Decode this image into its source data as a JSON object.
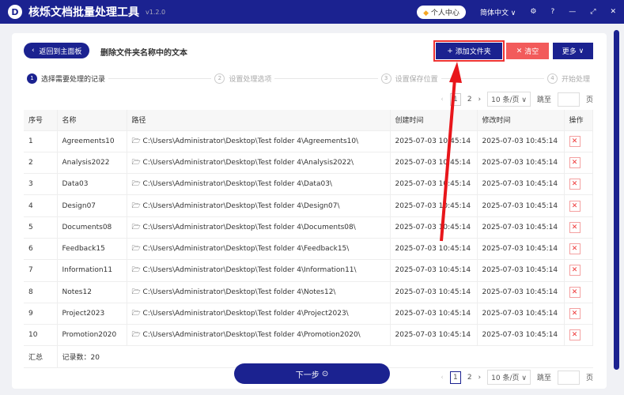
{
  "app": {
    "title": "核烁文档批量处理工具",
    "version": "v1.2.0",
    "personal_center": "个人中心",
    "language": "简体中文 ∨"
  },
  "toolbar": {
    "back": "返回到主面板",
    "page_title": "删除文件夹名称中的文本",
    "add_folder": "添加文件夹",
    "clear": "清空",
    "more": "更多"
  },
  "steps": [
    {
      "n": "1",
      "label": "选择需要处理的记录"
    },
    {
      "n": "2",
      "label": "设置处理选项"
    },
    {
      "n": "3",
      "label": "设置保存位置"
    },
    {
      "n": "4",
      "label": "开始处理"
    }
  ],
  "pager": {
    "pages": [
      "1",
      "2"
    ],
    "page_size": "10 条/页",
    "jump_label": "跳至",
    "page_unit": "页"
  },
  "table": {
    "headers": [
      "序号",
      "名称",
      "路径",
      "创建时间",
      "修改时间",
      "操作"
    ],
    "rows": [
      [
        "1",
        "Agreements10",
        "C:\\Users\\Administrator\\Desktop\\Test folder 4\\Agreements10\\",
        "2025-07-03 10:45:14",
        "2025-07-03 10:45:14"
      ],
      [
        "2",
        "Analysis2022",
        "C:\\Users\\Administrator\\Desktop\\Test folder 4\\Analysis2022\\",
        "2025-07-03 10:45:14",
        "2025-07-03 10:45:14"
      ],
      [
        "3",
        "Data03",
        "C:\\Users\\Administrator\\Desktop\\Test folder 4\\Data03\\",
        "2025-07-03 10:45:14",
        "2025-07-03 10:45:14"
      ],
      [
        "4",
        "Design07",
        "C:\\Users\\Administrator\\Desktop\\Test folder 4\\Design07\\",
        "2025-07-03 10:45:14",
        "2025-07-03 10:45:14"
      ],
      [
        "5",
        "Documents08",
        "C:\\Users\\Administrator\\Desktop\\Test folder 4\\Documents08\\",
        "2025-07-03 10:45:14",
        "2025-07-03 10:45:14"
      ],
      [
        "6",
        "Feedback15",
        "C:\\Users\\Administrator\\Desktop\\Test folder 4\\Feedback15\\",
        "2025-07-03 10:45:14",
        "2025-07-03 10:45:14"
      ],
      [
        "7",
        "Information11",
        "C:\\Users\\Administrator\\Desktop\\Test folder 4\\Information11\\",
        "2025-07-03 10:45:14",
        "2025-07-03 10:45:14"
      ],
      [
        "8",
        "Notes12",
        "C:\\Users\\Administrator\\Desktop\\Test folder 4\\Notes12\\",
        "2025-07-03 10:45:14",
        "2025-07-03 10:45:14"
      ],
      [
        "9",
        "Project2023",
        "C:\\Users\\Administrator\\Desktop\\Test folder 4\\Project2023\\",
        "2025-07-03 10:45:14",
        "2025-07-03 10:45:14"
      ],
      [
        "10",
        "Promotion2020",
        "C:\\Users\\Administrator\\Desktop\\Test folder 4\\Promotion2020\\",
        "2025-07-03 10:45:14",
        "2025-07-03 10:45:14"
      ]
    ],
    "summary_label": "汇总",
    "summary_value": "记录数：20"
  },
  "next_button": "下一步"
}
